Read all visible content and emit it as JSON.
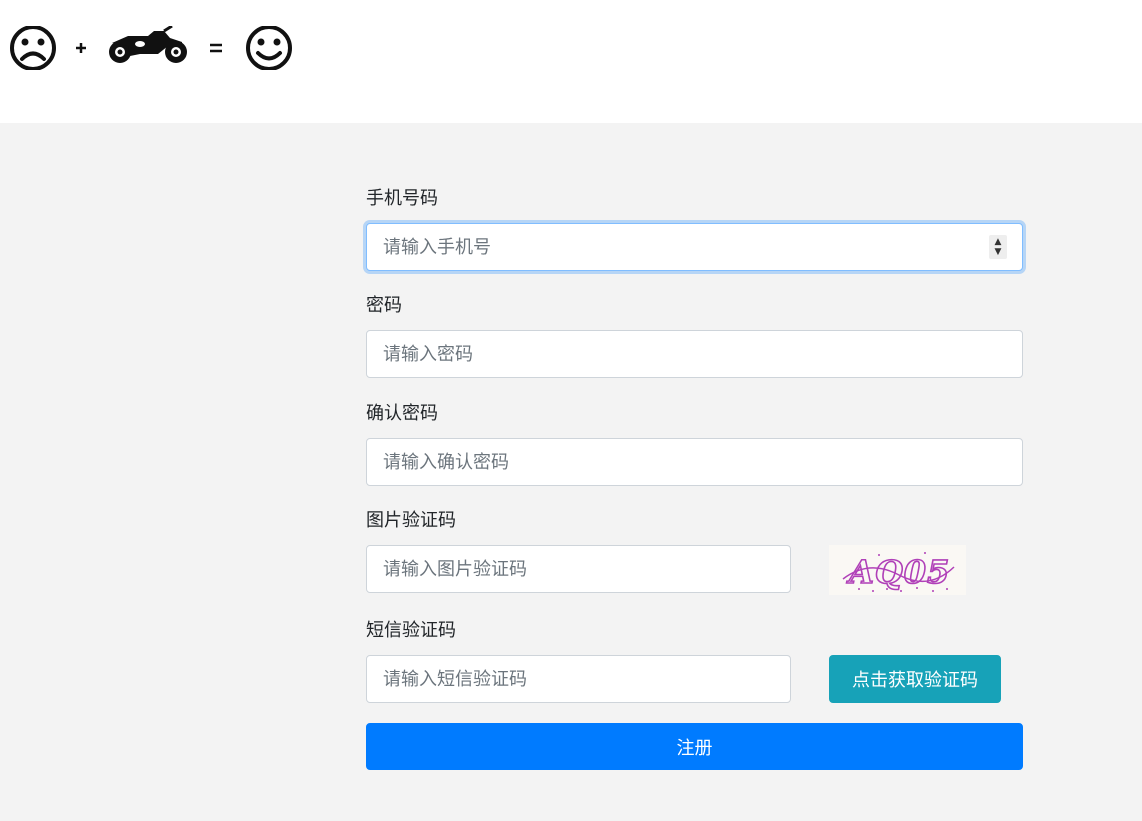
{
  "header": {
    "logo_icons": [
      "sad-face-icon",
      "plus-icon",
      "motorcycle-icon",
      "equals-icon",
      "happy-face-icon"
    ]
  },
  "form": {
    "phone": {
      "label": "手机号码",
      "placeholder": "请输入手机号"
    },
    "password": {
      "label": "密码",
      "placeholder": "请输入密码"
    },
    "confirm_password": {
      "label": "确认密码",
      "placeholder": "请输入确认密码"
    },
    "image_code": {
      "label": "图片验证码",
      "placeholder": "请输入图片验证码",
      "captcha_text": "AQ05"
    },
    "sms_code": {
      "label": "短信验证码",
      "placeholder": "请输入短信验证码",
      "button_label": "点击获取验证码"
    },
    "submit_label": "注册"
  },
  "colors": {
    "primary": "#007bff",
    "info": "#17a2b8",
    "background": "#f3f3f3",
    "captcha_ink": "#b040b8"
  }
}
